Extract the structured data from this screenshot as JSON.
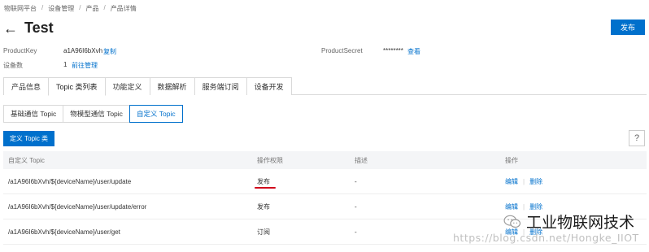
{
  "breadcrumb": [
    "物联网平台",
    "设备管理",
    "产品",
    "产品详情"
  ],
  "title": "Test",
  "publish_label": "发布",
  "info": {
    "product_key_label": "ProductKey",
    "product_key_value": "a1A96I6bXvh",
    "copy_label": "复制",
    "product_secret_label": "ProductSecret",
    "product_secret_value": "********",
    "view_label": "查看",
    "device_count_label": "设备数",
    "device_count_value": "1",
    "manage_label": "前往管理"
  },
  "main_tabs": [
    "产品信息",
    "Topic 类列表",
    "功能定义",
    "数据解析",
    "服务端订阅",
    "设备开发"
  ],
  "active_main_tab": "Topic 类列表",
  "sub_tabs": [
    "基础通信 Topic",
    "物模型通信 Topic",
    "自定义 Topic"
  ],
  "active_sub_tab": "自定义 Topic",
  "define_button_label": "定义 Topic 类",
  "help_label": "?",
  "table": {
    "headers": [
      "自定义 Topic",
      "操作权限",
      "描述",
      "操作"
    ],
    "rows": [
      {
        "topic": "/a1A96I6bXvh/${deviceName}/user/update",
        "permission": "发布",
        "description": "-",
        "edit": "编辑",
        "delete": "删除"
      },
      {
        "topic": "/a1A96I6bXvh/${deviceName}/user/update/error",
        "permission": "发布",
        "description": "-",
        "edit": "编辑",
        "delete": "删除"
      },
      {
        "topic": "/a1A96I6bXvh/${deviceName}/user/get",
        "permission": "订阅",
        "description": "-",
        "edit": "编辑",
        "delete": "删除"
      }
    ]
  },
  "watermark_text": "工业物联网技术",
  "url_watermark": "https://blog.csdn.net/Hongke_IIOT",
  "colors": {
    "accent": "#0070cc",
    "annotation": "#d0021b"
  }
}
